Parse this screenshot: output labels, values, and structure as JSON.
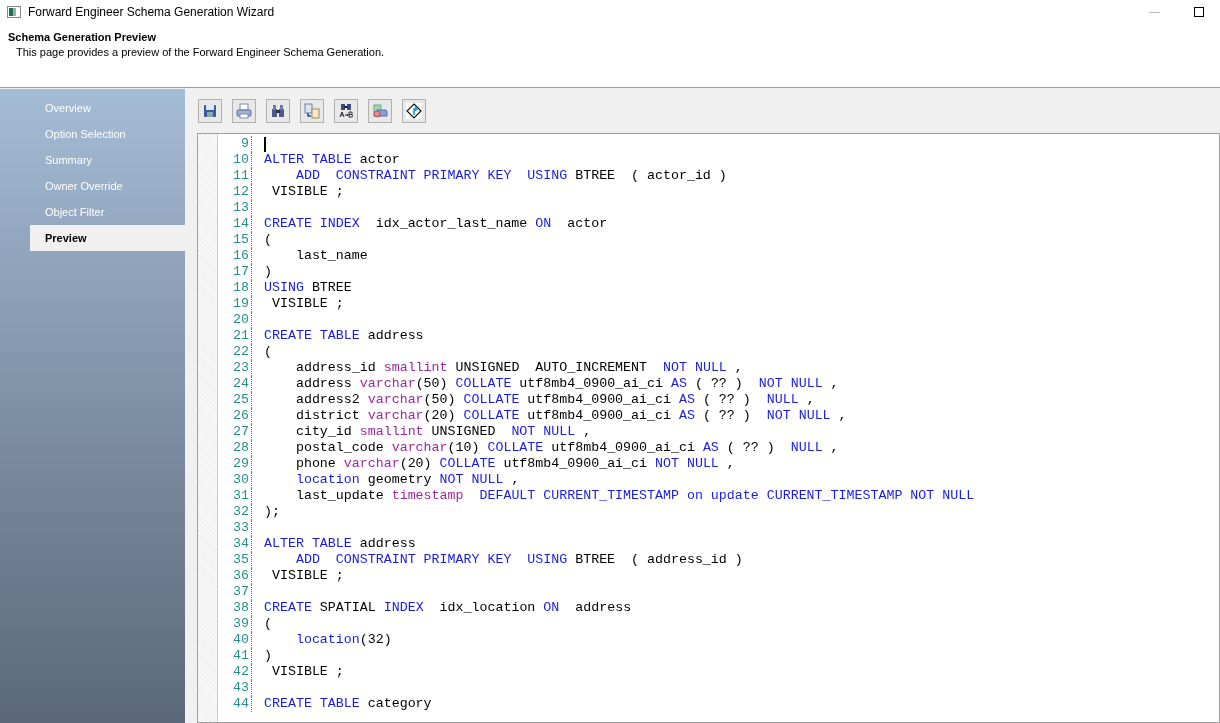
{
  "window": {
    "title": "Forward Engineer Schema Generation Wizard"
  },
  "header": {
    "title": "Schema Generation Preview",
    "description": "This page provides a preview of the Forward Engineer Schema Generation."
  },
  "sidebar": {
    "items": [
      {
        "label": "Overview",
        "selected": false
      },
      {
        "label": "Option Selection",
        "selected": false
      },
      {
        "label": "Summary",
        "selected": false
      },
      {
        "label": "Owner Override",
        "selected": false
      },
      {
        "label": "Object Filter",
        "selected": false
      },
      {
        "label": "Preview",
        "selected": true
      }
    ]
  },
  "editor": {
    "lines": [
      {
        "number": "9",
        "cursor": true
      },
      {
        "number": "10",
        "tokens": [
          {
            "kind": "keyword",
            "text": "ALTER TABLE"
          },
          {
            "kind": "plain",
            "text": " actor"
          }
        ]
      },
      {
        "number": "11",
        "tokens": [
          {
            "kind": "keyword",
            "text": "    ADD  CONSTRAINT PRIMARY KEY  USING"
          },
          {
            "kind": "plain",
            "text": " BTREE  ( actor_id )"
          }
        ]
      },
      {
        "number": "12",
        "tokens": [
          {
            "kind": "plain",
            "text": " VISIBLE ;"
          }
        ]
      },
      {
        "number": "13"
      },
      {
        "number": "14",
        "tokens": [
          {
            "kind": "keyword",
            "text": "CREATE INDEX"
          },
          {
            "kind": "plain",
            "text": "  idx_actor_last_name "
          },
          {
            "kind": "keyword",
            "text": "ON"
          },
          {
            "kind": "plain",
            "text": "  actor"
          }
        ]
      },
      {
        "number": "15",
        "tokens": [
          {
            "kind": "plain",
            "text": "("
          }
        ]
      },
      {
        "number": "16",
        "tokens": [
          {
            "kind": "plain",
            "text": "    last_name"
          }
        ]
      },
      {
        "number": "17",
        "tokens": [
          {
            "kind": "plain",
            "text": ")"
          }
        ]
      },
      {
        "number": "18",
        "tokens": [
          {
            "kind": "keyword",
            "text": "USING"
          },
          {
            "kind": "plain",
            "text": " BTREE"
          }
        ]
      },
      {
        "number": "19",
        "tokens": [
          {
            "kind": "plain",
            "text": " VISIBLE ;"
          }
        ]
      },
      {
        "number": "20"
      },
      {
        "number": "21",
        "tokens": [
          {
            "kind": "keyword",
            "text": "CREATE TABLE"
          },
          {
            "kind": "plain",
            "text": " address"
          }
        ]
      },
      {
        "number": "22",
        "tokens": [
          {
            "kind": "plain",
            "text": "("
          }
        ]
      },
      {
        "number": "23",
        "tokens": [
          {
            "kind": "plain",
            "text": "    address_id "
          },
          {
            "kind": "type",
            "text": "smallint"
          },
          {
            "kind": "plain",
            "text": " UNSIGNED  AUTO_INCREMENT  "
          },
          {
            "kind": "keyword",
            "text": "NOT NULL"
          },
          {
            "kind": "plain",
            "text": " ,"
          }
        ]
      },
      {
        "number": "24",
        "tokens": [
          {
            "kind": "plain",
            "text": "    address "
          },
          {
            "kind": "type",
            "text": "varchar"
          },
          {
            "kind": "plain",
            "text": "(50) "
          },
          {
            "kind": "keyword",
            "text": "COLLATE"
          },
          {
            "kind": "plain",
            "text": " utf8mb4_0900_ai_ci "
          },
          {
            "kind": "keyword",
            "text": "AS"
          },
          {
            "kind": "plain",
            "text": " ( ?? )  "
          },
          {
            "kind": "keyword",
            "text": "NOT NULL"
          },
          {
            "kind": "plain",
            "text": " ,"
          }
        ]
      },
      {
        "number": "25",
        "tokens": [
          {
            "kind": "plain",
            "text": "    address2 "
          },
          {
            "kind": "type",
            "text": "varchar"
          },
          {
            "kind": "plain",
            "text": "(50) "
          },
          {
            "kind": "keyword",
            "text": "COLLATE"
          },
          {
            "kind": "plain",
            "text": " utf8mb4_0900_ai_ci "
          },
          {
            "kind": "keyword",
            "text": "AS"
          },
          {
            "kind": "plain",
            "text": " ( ?? )  "
          },
          {
            "kind": "keyword",
            "text": "NULL"
          },
          {
            "kind": "plain",
            "text": " ,"
          }
        ]
      },
      {
        "number": "26",
        "tokens": [
          {
            "kind": "plain",
            "text": "    district "
          },
          {
            "kind": "type",
            "text": "varchar"
          },
          {
            "kind": "plain",
            "text": "(20) "
          },
          {
            "kind": "keyword",
            "text": "COLLATE"
          },
          {
            "kind": "plain",
            "text": " utf8mb4_0900_ai_ci "
          },
          {
            "kind": "keyword",
            "text": "AS"
          },
          {
            "kind": "plain",
            "text": " ( ?? )  "
          },
          {
            "kind": "keyword",
            "text": "NOT NULL"
          },
          {
            "kind": "plain",
            "text": " ,"
          }
        ]
      },
      {
        "number": "27",
        "tokens": [
          {
            "kind": "plain",
            "text": "    city_id "
          },
          {
            "kind": "type",
            "text": "smallint"
          },
          {
            "kind": "plain",
            "text": " UNSIGNED  "
          },
          {
            "kind": "keyword",
            "text": "NOT NULL"
          },
          {
            "kind": "plain",
            "text": " ,"
          }
        ]
      },
      {
        "number": "28",
        "tokens": [
          {
            "kind": "plain",
            "text": "    postal_code "
          },
          {
            "kind": "type",
            "text": "varchar"
          },
          {
            "kind": "plain",
            "text": "(10) "
          },
          {
            "kind": "keyword",
            "text": "COLLATE"
          },
          {
            "kind": "plain",
            "text": " utf8mb4_0900_ai_ci "
          },
          {
            "kind": "keyword",
            "text": "AS"
          },
          {
            "kind": "plain",
            "text": " ( ?? )  "
          },
          {
            "kind": "keyword",
            "text": "NULL"
          },
          {
            "kind": "plain",
            "text": " ,"
          }
        ]
      },
      {
        "number": "29",
        "tokens": [
          {
            "kind": "plain",
            "text": "    phone "
          },
          {
            "kind": "type",
            "text": "varchar"
          },
          {
            "kind": "plain",
            "text": "(20) "
          },
          {
            "kind": "keyword",
            "text": "COLLATE"
          },
          {
            "kind": "plain",
            "text": " utf8mb4_0900_ai_ci "
          },
          {
            "kind": "keyword",
            "text": "NOT NULL"
          },
          {
            "kind": "plain",
            "text": " ,"
          }
        ]
      },
      {
        "number": "30",
        "tokens": [
          {
            "kind": "keyword",
            "text": "    location"
          },
          {
            "kind": "plain",
            "text": " geometry "
          },
          {
            "kind": "keyword",
            "text": "NOT NULL"
          },
          {
            "kind": "plain",
            "text": " ,"
          }
        ]
      },
      {
        "number": "31",
        "tokens": [
          {
            "kind": "plain",
            "text": "    last_update "
          },
          {
            "kind": "type",
            "text": "timestamp"
          },
          {
            "kind": "keyword",
            "text": "  DEFAULT CURRENT_TIMESTAMP on update CURRENT_TIMESTAMP NOT NULL"
          }
        ]
      },
      {
        "number": "32",
        "tokens": [
          {
            "kind": "plain",
            "text": ");"
          }
        ]
      },
      {
        "number": "33"
      },
      {
        "number": "34",
        "tokens": [
          {
            "kind": "keyword",
            "text": "ALTER TABLE"
          },
          {
            "kind": "plain",
            "text": " address"
          }
        ]
      },
      {
        "number": "35",
        "tokens": [
          {
            "kind": "keyword",
            "text": "    ADD  CONSTRAINT PRIMARY KEY  USING"
          },
          {
            "kind": "plain",
            "text": " BTREE  ( address_id )"
          }
        ]
      },
      {
        "number": "36",
        "tokens": [
          {
            "kind": "plain",
            "text": " VISIBLE ;"
          }
        ]
      },
      {
        "number": "37"
      },
      {
        "number": "38",
        "tokens": [
          {
            "kind": "keyword",
            "text": "CREATE"
          },
          {
            "kind": "plain",
            "text": " SPATIAL "
          },
          {
            "kind": "keyword",
            "text": "INDEX"
          },
          {
            "kind": "plain",
            "text": "  idx_location "
          },
          {
            "kind": "keyword",
            "text": "ON"
          },
          {
            "kind": "plain",
            "text": "  address"
          }
        ]
      },
      {
        "number": "39",
        "tokens": [
          {
            "kind": "plain",
            "text": "("
          }
        ]
      },
      {
        "number": "40",
        "tokens": [
          {
            "kind": "keyword",
            "text": "    location"
          },
          {
            "kind": "plain",
            "text": "(32)"
          }
        ]
      },
      {
        "number": "41",
        "tokens": [
          {
            "kind": "plain",
            "text": ")"
          }
        ]
      },
      {
        "number": "42",
        "tokens": [
          {
            "kind": "plain",
            "text": " VISIBLE ;"
          }
        ]
      },
      {
        "number": "43"
      },
      {
        "number": "44",
        "tokens": [
          {
            "kind": "keyword",
            "text": "CREATE TABLE"
          },
          {
            "kind": "plain",
            "text": " category"
          }
        ]
      }
    ]
  }
}
